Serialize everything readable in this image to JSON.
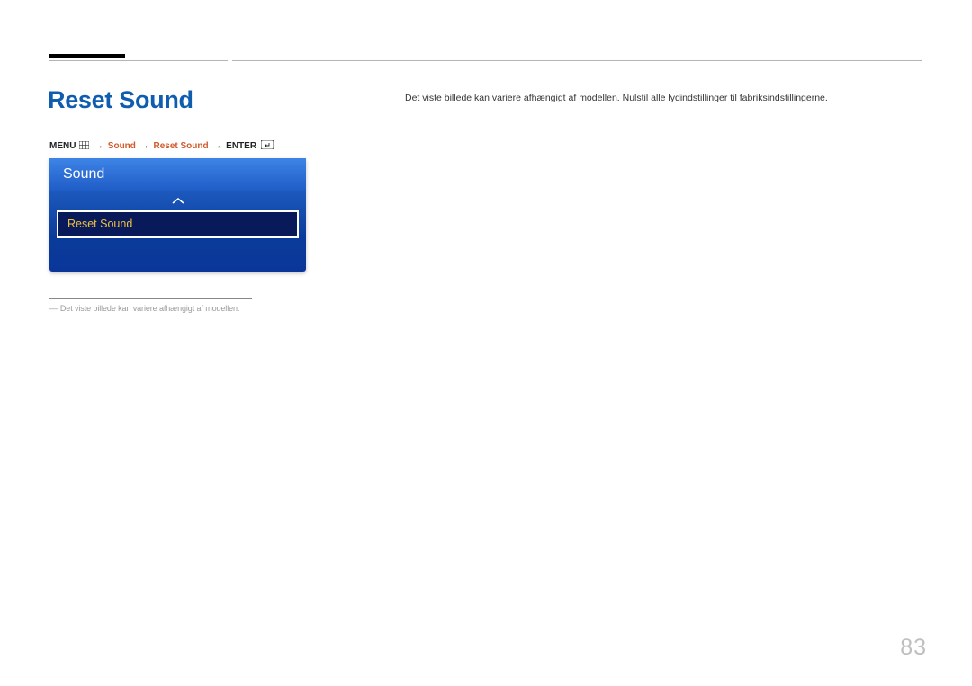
{
  "page": {
    "title": "Reset Sound",
    "description": "Det viste billede kan variere afhængigt af modellen. Nulstil alle lydindstillinger til fabriksindstillingerne.",
    "pageNumber": "83"
  },
  "breadcrumb": {
    "menuLabel": "MENU",
    "path1": "Sound",
    "path2": "Reset Sound",
    "enterLabel": "ENTER"
  },
  "menuBox": {
    "header": "Sound",
    "selectedItem": "Reset Sound"
  },
  "footnote": {
    "text": "Det viste billede kan variere afhængigt af modellen."
  }
}
